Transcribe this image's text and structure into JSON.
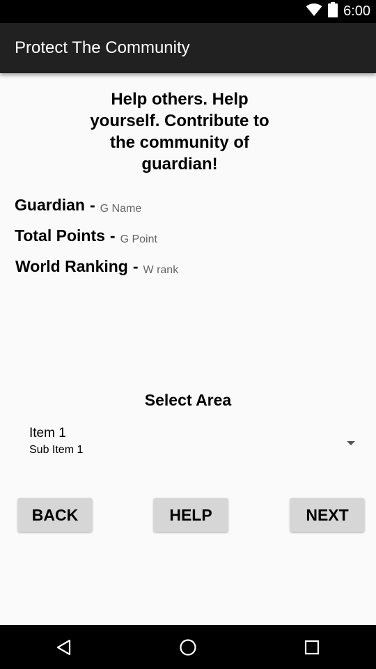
{
  "status_bar": {
    "time": "6:00",
    "icons": [
      "wifi-icon",
      "battery-icon"
    ]
  },
  "app_bar": {
    "title": "Protect The Community"
  },
  "main": {
    "tagline": "Help others. Help yourself. Contribute to the community of guardian!",
    "info": [
      {
        "label": "Guardian",
        "value": "G Name"
      },
      {
        "label": "Total Points",
        "value": "G Point"
      },
      {
        "label": "World Ranking",
        "value": "W rank"
      }
    ],
    "select_area_title": "Select Area",
    "spinner": {
      "item": "Item 1",
      "sub_item": "Sub Item 1"
    },
    "buttons": {
      "back": "BACK",
      "help": "HELP",
      "next": "NEXT"
    }
  },
  "nav_bar": {
    "icons": [
      "back-icon",
      "home-icon",
      "recents-icon"
    ]
  },
  "colors": {
    "status_bar": "#000000",
    "app_bar": "#212121",
    "background": "#fafafa",
    "button": "#d6d6d6"
  }
}
